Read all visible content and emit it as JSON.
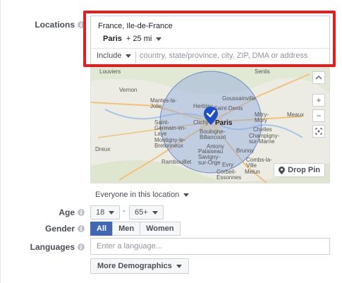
{
  "labels": {
    "locations": "Locations",
    "age": "Age",
    "gender": "Gender",
    "languages": "Languages"
  },
  "location": {
    "country": "France, Ile-de-France",
    "city": "Paris",
    "radius": "+ 25 mi",
    "include": "Include",
    "placeholder": "country, state/province, city, ZIP, DMA or address"
  },
  "map": {
    "places": [
      "Louviers",
      "Senlis",
      "Vernon",
      "Goussainville",
      "Mantes-la-Jolie",
      "Herblay",
      "Saint-Denis",
      "Meaux",
      "Clichy",
      "Paris",
      "Saint-Germain-en-Laye",
      "Boulogne-Billancourt",
      "Montigny-le-Bretonneux",
      "Antony",
      "Chelles",
      "Champigny-sur-Marne",
      "Mitry-Mory",
      "Rambouillet",
      "Palaiseau",
      "Brunoy",
      "Savigny-sur-Orge",
      "Combs-la-Ville",
      "Corbeil-Essonnes",
      "Melun",
      "Evry",
      "Dreux"
    ],
    "zoom_in": "+",
    "zoom_out": "−",
    "drop_pin": "Drop Pin"
  },
  "everyone": "Everyone in this location",
  "age": {
    "min": "18",
    "dash": "-",
    "max": "65+"
  },
  "gender_options": [
    "All",
    "Men",
    "Women"
  ],
  "gender_selected": "All",
  "languages": {
    "placeholder": "Enter a language..."
  },
  "more_demographics": "More Demographics",
  "colors": {
    "accent": "#4267b2",
    "highlight": "#e41e1e",
    "pin": "#1e4fc7",
    "radius_fill": "#8fa9dc"
  },
  "icons": {
    "info": "info-icon",
    "caret": "caret-down-icon",
    "pin": "location-pin-icon",
    "recenter": "recenter-icon"
  }
}
